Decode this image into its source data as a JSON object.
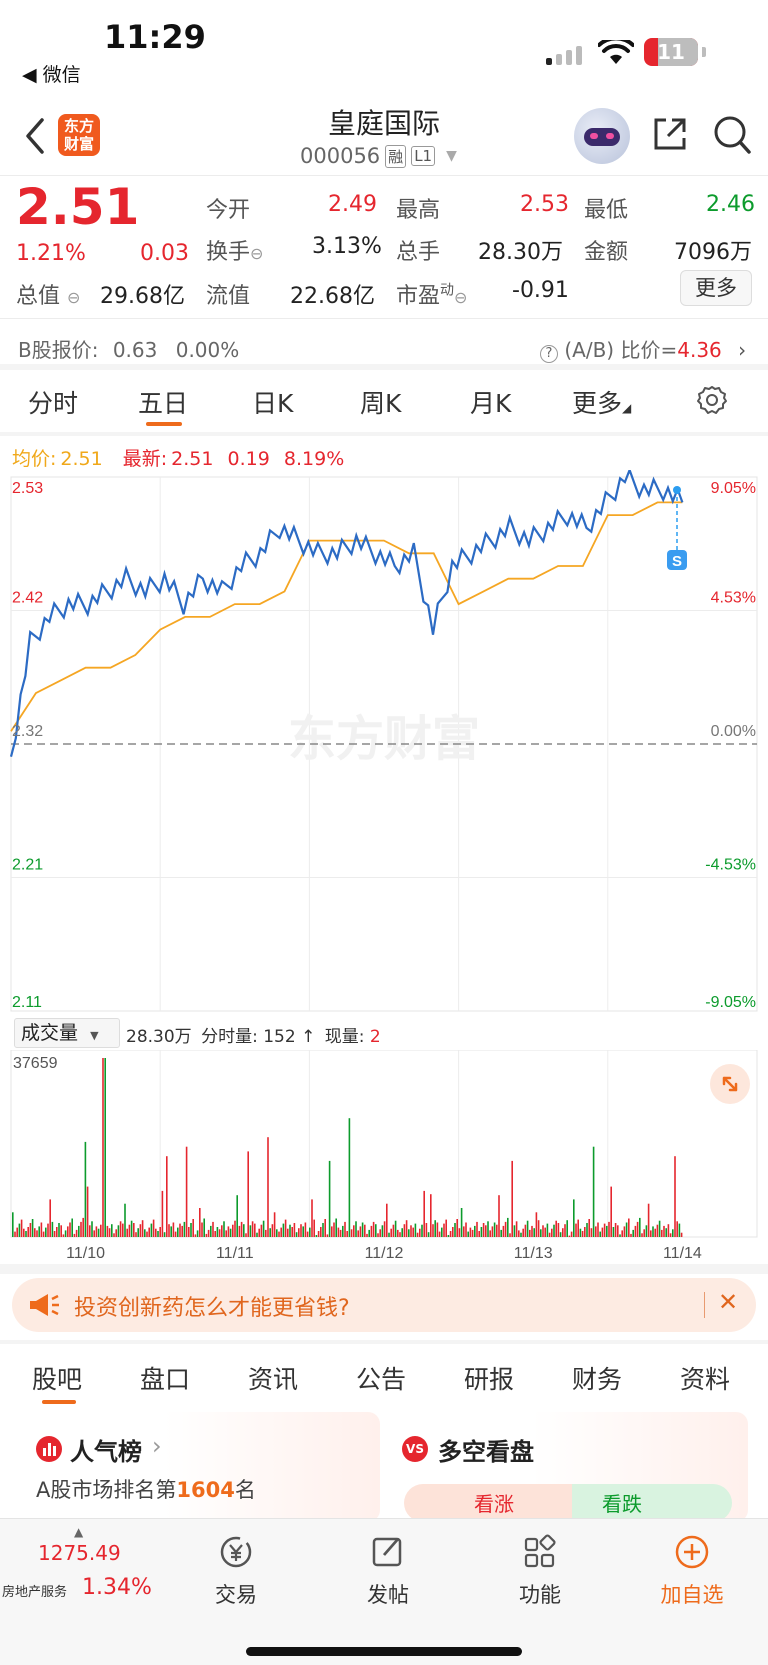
{
  "status_bar": {
    "time": "11:29",
    "back_app": "◀ 微信",
    "battery": "11"
  },
  "header": {
    "title": "皇庭国际",
    "code": "000056",
    "badge_rong": "融",
    "badge_level": "L1",
    "logo_line1": "东方",
    "logo_line2": "财富"
  },
  "quote": {
    "price": "2.51",
    "change_pct": "1.21%",
    "change": "0.03",
    "open_label": "今开",
    "open": "2.49",
    "high_label": "最高",
    "high": "2.53",
    "low_label": "最低",
    "low": "2.46",
    "turnover_label": "换手",
    "turnover": "3.13%",
    "volume_label": "总手",
    "volume": "28.30万",
    "amount_label": "金额",
    "amount": "7096万",
    "mcap_label": "总值",
    "mcap": "29.68亿",
    "float_label": "流值",
    "float_mcap": "22.68亿",
    "pe_label": "市盈",
    "pe_sup": "动",
    "pe": "-0.91",
    "more_button": "更多"
  },
  "b_share": {
    "label": "B股报价:",
    "price": "0.63",
    "pct": "0.00%",
    "ratio_label": "(A/B) 比价=",
    "ratio": "4.36"
  },
  "chart_tabs": [
    "分时",
    "五日",
    "日K",
    "周K",
    "月K",
    "更多"
  ],
  "active_chart_tab": 1,
  "legend": {
    "avg_label": "均价:",
    "avg": "2.51",
    "latest_label": "最新:",
    "latest": "2.51",
    "latest_change": "0.19",
    "latest_pct": "8.19%"
  },
  "watermark": "东方财富",
  "s_marker": "S",
  "volume_bar": {
    "selector": "成交量",
    "total": "28.30万",
    "tick_label": "分时量:",
    "tick": "152",
    "arrow": "↑",
    "now_label": "现量:",
    "now": "2"
  },
  "colors": {
    "up": "#e5262e",
    "down": "#0c9b2c",
    "price_line": "#2c6bc4",
    "avg_line": "#f5a623",
    "accent": "#ee6b1c"
  },
  "chart_data": [
    {
      "type": "line",
      "x": [
        "11/10",
        "11/11",
        "11/12",
        "11/13",
        "11/14"
      ],
      "ylim": [
        2.11,
        2.53
      ],
      "y_ticks": [
        "2.53",
        "2.42",
        "2.32",
        "2.21",
        "2.11"
      ],
      "y_right_ticks": [
        "9.05%",
        "4.53%",
        "0.00%",
        "-4.53%",
        "-9.05%"
      ],
      "prev_close": 2.32,
      "series": [
        {
          "values": [
            2.31,
            2.4,
            2.42,
            2.43,
            2.43,
            2.44,
            2.45,
            2.44,
            2.45,
            2.43,
            2.45,
            2.44,
            2.46,
            2.47,
            2.49,
            2.48,
            2.47,
            2.47,
            2.48,
            2.47,
            2.46,
            2.47,
            2.41,
            2.46,
            2.47,
            2.48,
            2.49,
            2.48,
            2.49,
            2.5,
            2.49,
            2.51,
            2.53,
            2.52,
            2.52,
            2.51
          ]
        },
        {
          "values": [
            2.33,
            2.36,
            2.37,
            2.38,
            2.38,
            2.39,
            2.41,
            2.42,
            2.42,
            2.43,
            2.43,
            2.44,
            2.48,
            2.48,
            2.48,
            2.48,
            2.47,
            2.47,
            2.43,
            2.44,
            2.45,
            2.45,
            2.46,
            2.46,
            2.5,
            2.5,
            2.51,
            2.51
          ]
        }
      ]
    },
    {
      "type": "bar",
      "title": "成交量",
      "ymax_label": "37659",
      "ylim": [
        0,
        37659
      ],
      "peaks": [
        37659,
        19000,
        21000,
        25000,
        9000,
        16000,
        19000,
        17000,
        20000,
        17000,
        18000,
        16000
      ]
    }
  ],
  "ad_banner": {
    "text": "投资创新药怎么才能更省钱?",
    "close": "✕"
  },
  "feature_tabs": [
    "股吧",
    "盘口",
    "资讯",
    "公告",
    "研报",
    "财务",
    "资料"
  ],
  "active_feature_tab": 0,
  "cards": {
    "rank_title": "人气榜",
    "rank_text_prefix": "A股市场排名第",
    "rank_number": "1604",
    "rank_text_suffix": "名",
    "bull_title": "多空看盘",
    "bull_up": "看涨",
    "bull_down": "看跌"
  },
  "bottom_nav": {
    "index_value": "1275.49",
    "index_name": "房地产服务",
    "index_pct": "1.34%",
    "items": [
      "交易",
      "发帖",
      "功能",
      "加自选"
    ]
  }
}
